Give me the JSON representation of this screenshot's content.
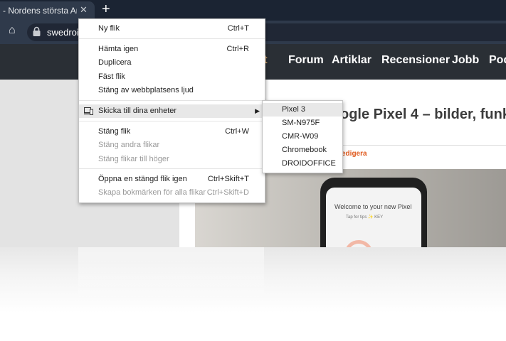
{
  "tab": {
    "title": "- Nordens största Andr",
    "close": "✕",
    "new_tab": "+"
  },
  "toolbar": {
    "home": "⌂",
    "url": "swedroi"
  },
  "site": {
    "nav": [
      "rt",
      "Forum",
      "Artiklar",
      "Recensioner",
      "Jobb",
      "Pod"
    ],
    "headline": "ogle Pixel 4 – bilder, funk",
    "edit_link": "edigera",
    "phone_welcome": "Welcome to your new Pixel",
    "phone_tip": "Tap for tips  ✨ KEY"
  },
  "context_menu": {
    "new_tab": {
      "label": "Ny flik",
      "shortcut": "Ctrl+T"
    },
    "reload": {
      "label": "Hämta igen",
      "shortcut": "Ctrl+R"
    },
    "duplicate": {
      "label": "Duplicera"
    },
    "pin": {
      "label": "Fäst flik"
    },
    "mute": {
      "label": "Stäng av webbplatsens ljud"
    },
    "send": {
      "label": "Skicka till dina enheter",
      "arrow": "▶"
    },
    "close": {
      "label": "Stäng flik",
      "shortcut": "Ctrl+W"
    },
    "close_others": {
      "label": "Stäng andra flikar"
    },
    "close_right": {
      "label": "Stäng flikar till höger"
    },
    "reopen": {
      "label": "Öppna en stängd flik igen",
      "shortcut": "Ctrl+Skift+T"
    },
    "bookmark_all": {
      "label": "Skapa bokmärken för alla flikar ...",
      "shortcut": "Ctrl+Skift+D"
    }
  },
  "devices_submenu": [
    "Pixel 3",
    "SM-N975F",
    "CMR-W09",
    "Chromebook",
    "DROIDOFFICE"
  ]
}
